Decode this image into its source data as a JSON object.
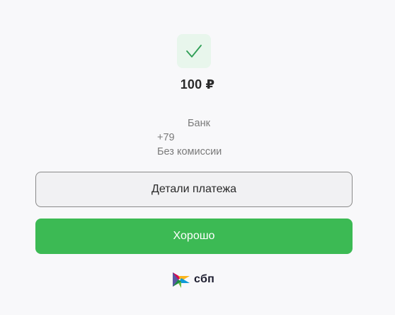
{
  "payment": {
    "amount": "100 ₽",
    "bank": "Банк",
    "phone": "+79",
    "fee": "Без комиссии"
  },
  "buttons": {
    "details_label": "Детали платежа",
    "ok_label": "Хорошо"
  },
  "logo": {
    "text": "сбп"
  },
  "colors": {
    "accent": "#3cba54",
    "check": "#2e9e55",
    "icon_bg": "#e8f6ec"
  },
  "icons": {
    "status": "checkmark-icon",
    "logo": "sbp-logo-icon"
  }
}
